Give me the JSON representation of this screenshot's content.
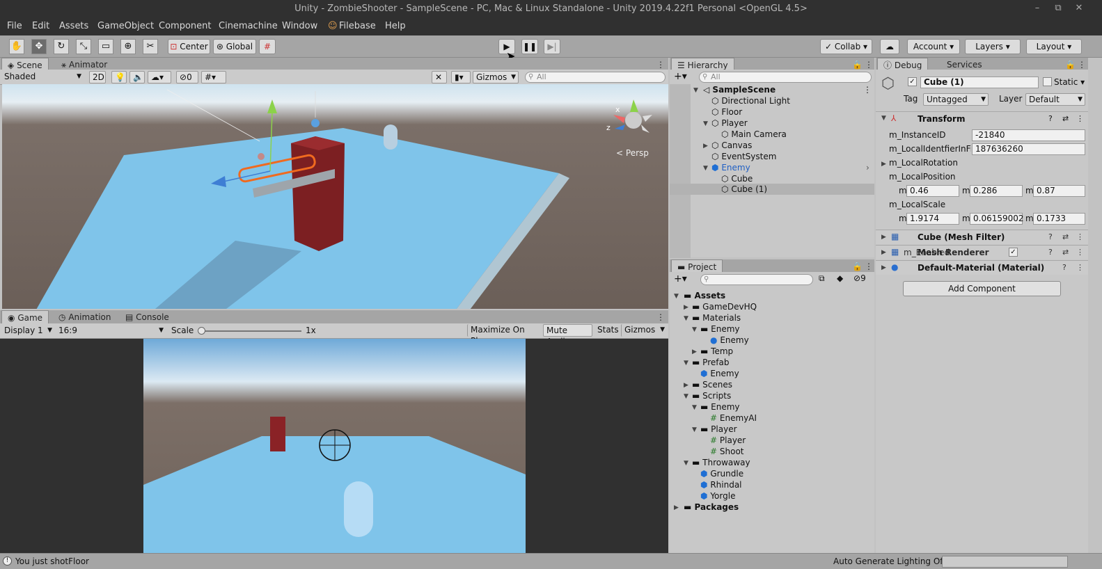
{
  "window": {
    "title": "Unity - ZombieShooter - SampleScene - PC, Mac & Linux Standalone - Unity 2019.4.22f1 Personal <OpenGL 4.5>",
    "minimize": "–",
    "maximize": "⧉",
    "close": "✕"
  },
  "menu": [
    "File",
    "Edit",
    "Assets",
    "GameObject",
    "Component",
    "Cinemachine",
    "Window",
    "Filebase",
    "Help"
  ],
  "toolbar": {
    "pivot": "Center",
    "space": "Global",
    "collab": "Collab",
    "account": "Account",
    "layers": "Layers",
    "layout": "Layout"
  },
  "scene_panel": {
    "tabs": [
      "Scene",
      "Animator"
    ],
    "shading": "Shaded",
    "mode_2d": "2D",
    "hidden_count": "0",
    "gizmos": "Gizmos",
    "search_placeholder": "All",
    "persp": "Persp",
    "axis_x": "x",
    "axis_z": "z"
  },
  "game_panel": {
    "tabs": [
      "Game",
      "Animation",
      "Console"
    ],
    "display": "Display 1",
    "aspect": "16:9",
    "scale_label": "Scale",
    "scale_value": "1x",
    "maximize_on_play": "Maximize On Play",
    "mute_audio": "Mute Audio",
    "stats": "Stats",
    "gizmos": "Gizmos"
  },
  "hierarchy": {
    "tab": "Hierarchy",
    "search_placeholder": "All",
    "scene": "SampleScene",
    "items": [
      "Directional Light",
      "Floor",
      "Player",
      "Main Camera",
      "Canvas",
      "EventSystem",
      "Enemy",
      "Cube",
      "Cube (1)"
    ]
  },
  "project": {
    "tab": "Project",
    "hidden_count": "9",
    "items": [
      "Assets",
      "GameDevHQ",
      "Materials",
      "Enemy",
      "Enemy",
      "Temp",
      "Prefab",
      "Enemy",
      "Scenes",
      "Scripts",
      "Enemy",
      "EnemyAI",
      "Player",
      "Player",
      "Shoot",
      "Throwaway",
      "Grundle",
      "Rhindal",
      "Yorgle",
      "Packages"
    ]
  },
  "inspector": {
    "tabs": [
      "Debug",
      "Services"
    ],
    "object_name": "Cube (1)",
    "static_label": "Static",
    "tag_label": "Tag",
    "tag_value": "Untagged",
    "layer_label": "Layer",
    "layer_value": "Default",
    "transform": {
      "title": "Transform",
      "instance_id_label": "m_InstanceID",
      "instance_id": "-21840",
      "local_id_label": "m_LocalIdentfierInFile",
      "local_id": "187636260",
      "local_rotation_label": "m_LocalRotation",
      "local_position_label": "m_LocalPosition",
      "pos_x": "0.46",
      "pos_y": "0.286",
      "pos_z": "0.87",
      "local_scale_label": "m_LocalScale",
      "scale_x": "1.9174",
      "scale_y": "0.06159002",
      "scale_z": "0.1733",
      "axis_prefix": "m"
    },
    "components": [
      "Cube (Mesh Filter)",
      "Mesh Renderer",
      "Default-Material (Material)"
    ],
    "overlap_label": "m_Enabled",
    "add_component": "Add Component"
  },
  "status": {
    "message": "You just shotFloor",
    "lighting": "Auto Generate Lighting Off"
  }
}
